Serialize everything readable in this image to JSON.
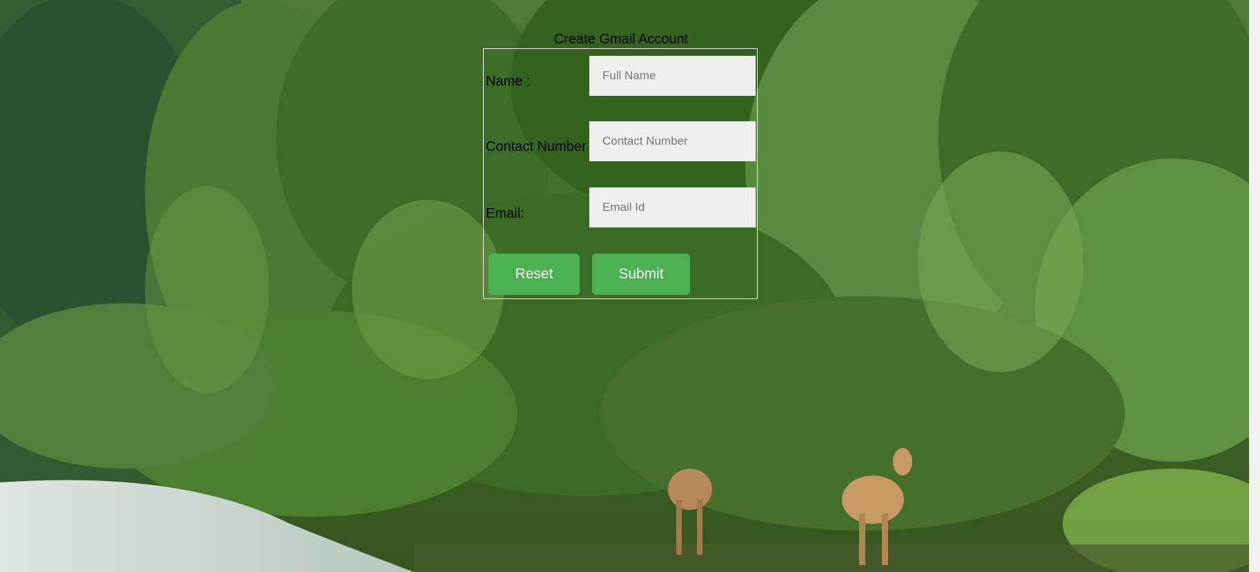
{
  "page": {
    "title": "Create Gmail Account"
  },
  "form": {
    "name_label": "Name :",
    "name_placeholder": "Full Name",
    "contact_label": "Contact Number",
    "contact_placeholder": "Contact Number",
    "email_label": "Email:",
    "email_placeholder": "Email Id",
    "reset_label": "Reset",
    "submit_label": "Submit"
  },
  "colors": {
    "button_bg": "#4cb050",
    "input_bg": "#efefef",
    "background_forest": "#3f6f2a"
  }
}
